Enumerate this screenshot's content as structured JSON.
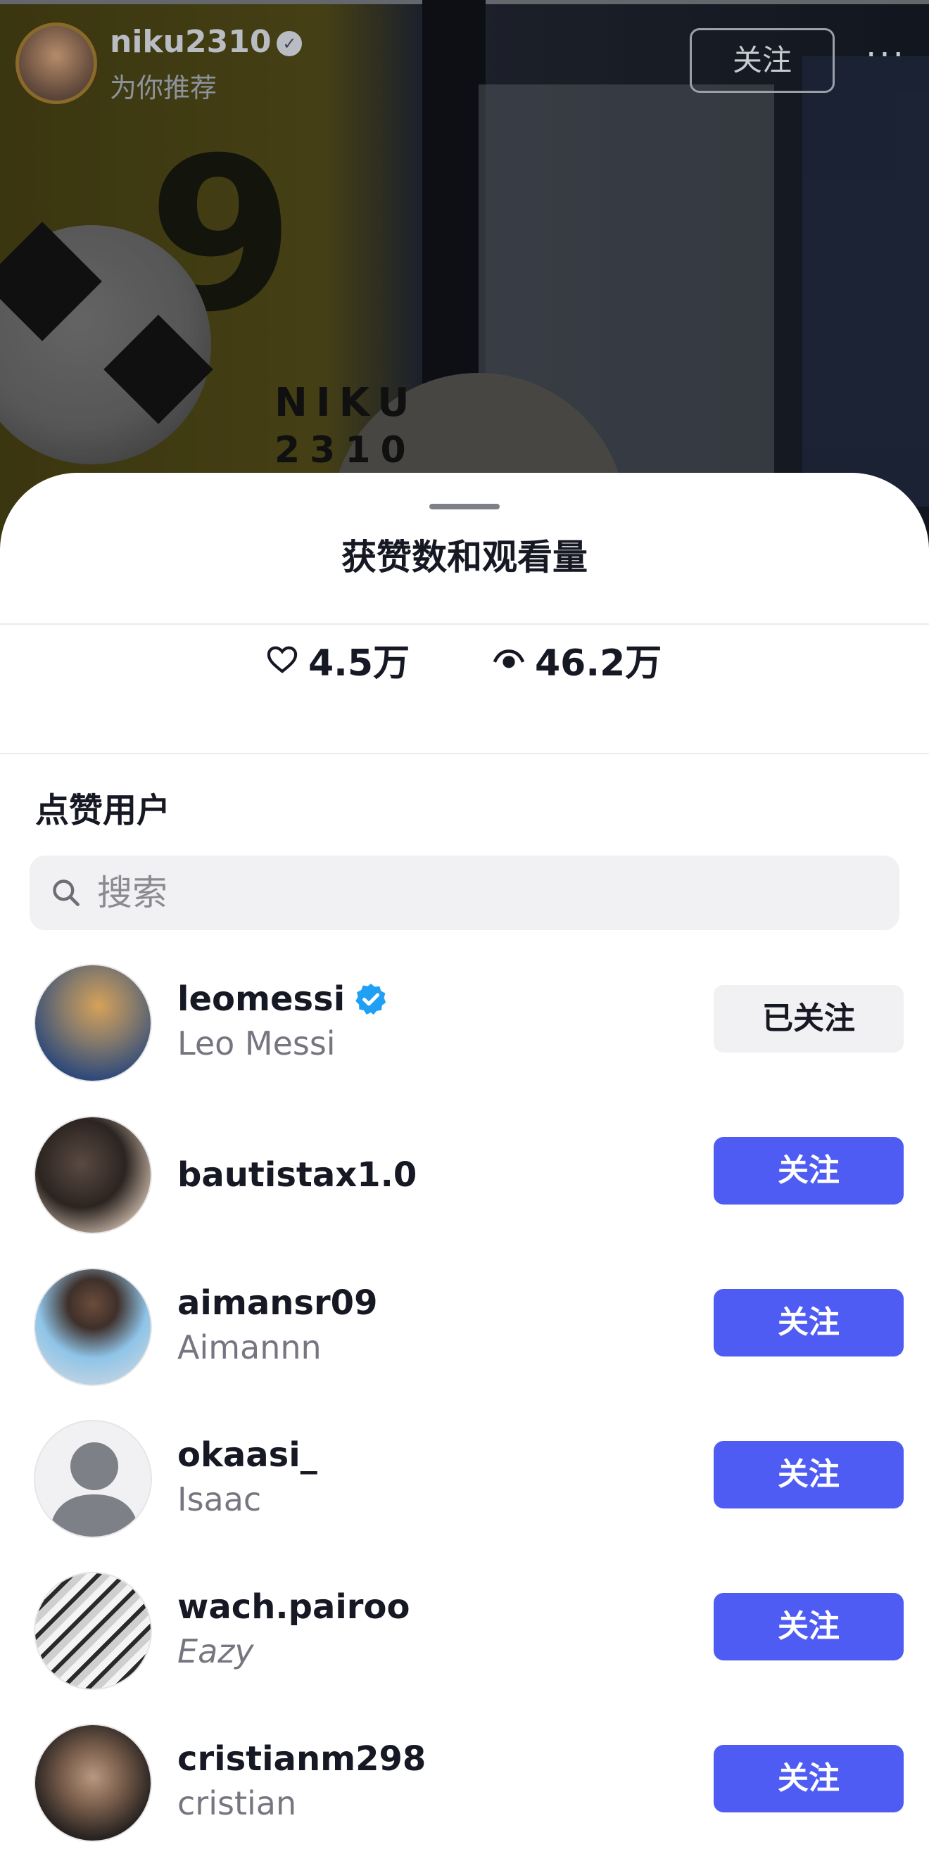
{
  "video_header": {
    "username": "niku2310",
    "subtitle": "为你推荐",
    "follow_label": "关注",
    "more_label": "···"
  },
  "background_text": {
    "number": "9",
    "niku": "NIKU",
    "niku_num": "2310"
  },
  "sheet": {
    "title": "获赞数和观看量",
    "likes": "4.5万",
    "views": "46.2万",
    "section_title": "点赞用户",
    "search_placeholder": "搜索"
  },
  "users": [
    {
      "username": "leomessi",
      "nickname": "Leo Messi",
      "verified": true,
      "button": "已关注"
    },
    {
      "username": "bautistax1.0",
      "nickname": "",
      "verified": false,
      "button": "关注"
    },
    {
      "username": "aimansr09",
      "nickname": "Aimannn",
      "verified": false,
      "button": "关注"
    },
    {
      "username": "okaasi_",
      "nickname": "Isaac",
      "verified": false,
      "button": "关注"
    },
    {
      "username": "wach.pairoo",
      "nickname": "Eazy",
      "verified": false,
      "button": "关注"
    },
    {
      "username": "cristianm298",
      "nickname": "cristian",
      "verified": false,
      "button": "关注"
    }
  ],
  "colors": {
    "follow_button": "#4f5cf3",
    "following_button": "#f1f1f3",
    "verified_badge": "#20a0f5"
  }
}
